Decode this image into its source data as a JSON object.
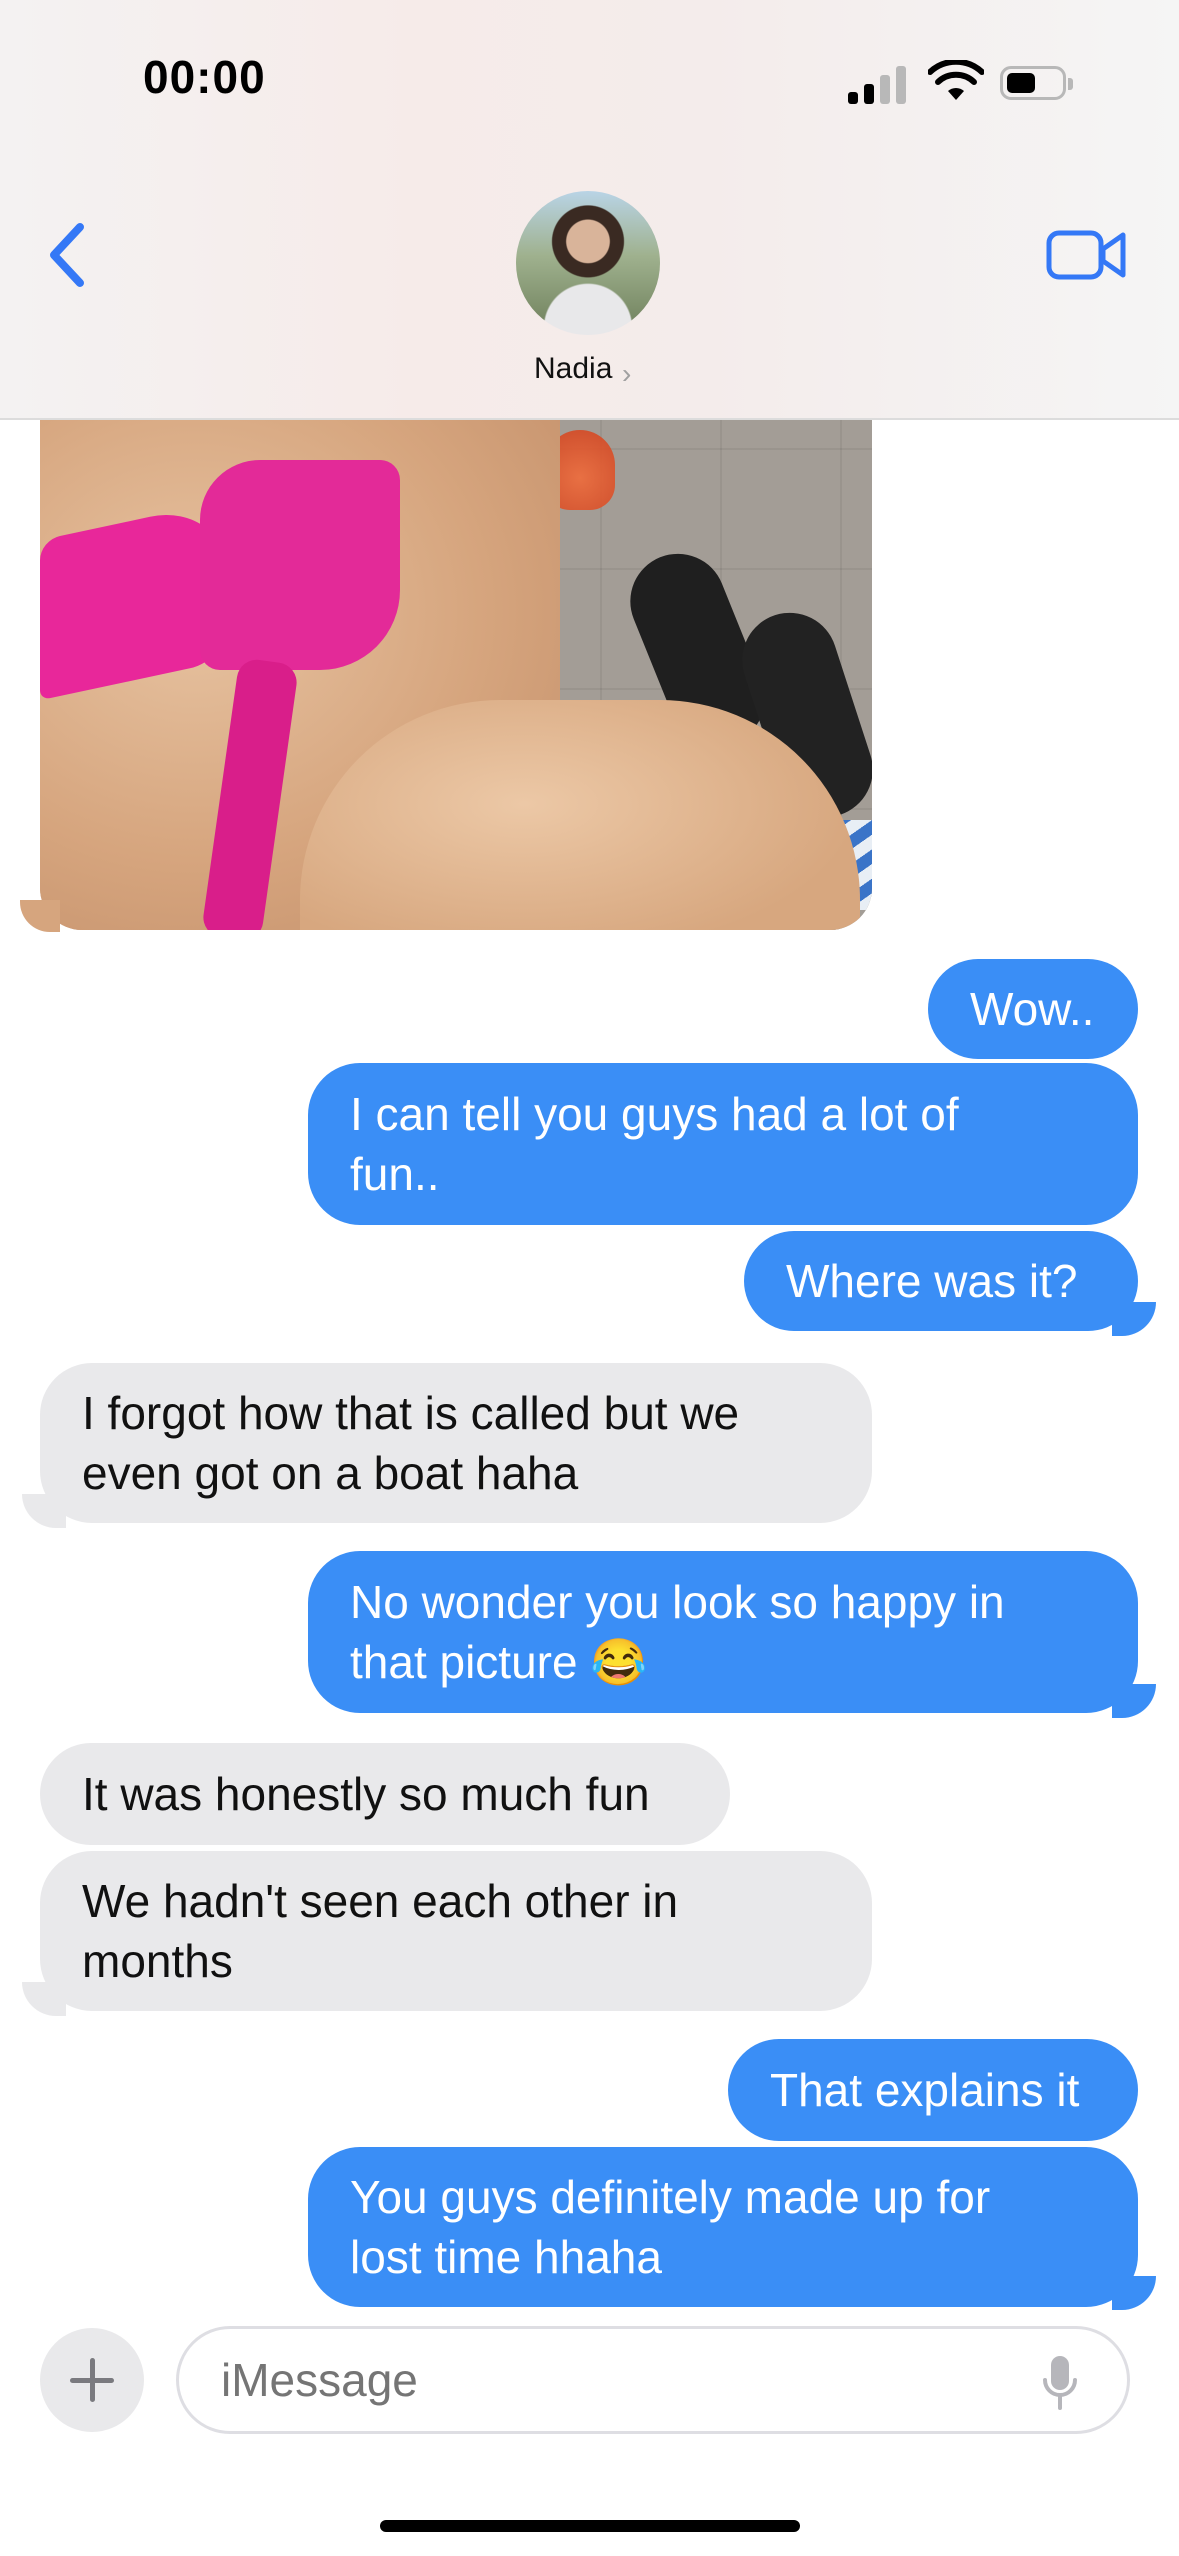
{
  "status_bar": {
    "time": "00:00"
  },
  "header": {
    "contact_name": "Nadia",
    "chevron": "›"
  },
  "icons": {
    "back": "chevron-left-icon",
    "video": "video-camera-icon",
    "plus": "plus-icon",
    "mic": "microphone-icon"
  },
  "colors": {
    "outgoing": "#3a8ef6",
    "incoming": "#e9e9eb",
    "accent": "#3478f6"
  },
  "messages": [
    {
      "dir": "out",
      "text": "Wow.."
    },
    {
      "dir": "out",
      "text": "I can tell you guys had a lot of fun.."
    },
    {
      "dir": "out",
      "text": "Where was it?"
    },
    {
      "dir": "in",
      "text": "I forgot how that is called but we even got on a boat haha"
    },
    {
      "dir": "out",
      "text": "No wonder you look so happy in that picture 😂"
    },
    {
      "dir": "in",
      "text": "It was honestly so much fun"
    },
    {
      "dir": "in",
      "text": "We hadn't seen each other in months"
    },
    {
      "dir": "out",
      "text": "That explains it"
    },
    {
      "dir": "out",
      "text": "You guys definitely made up for lost time hhaha"
    }
  ],
  "composer": {
    "placeholder": "iMessage"
  }
}
